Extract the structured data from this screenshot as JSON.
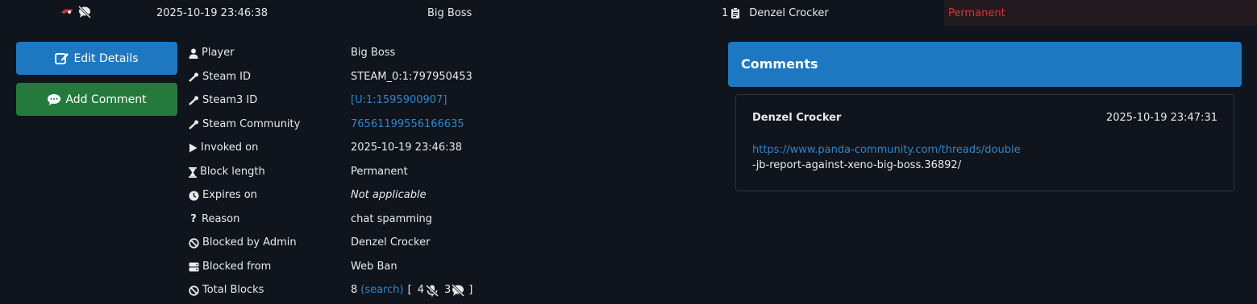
{
  "top_row": {
    "date": "2025-10-19 23:46:38",
    "player": "Big Boss",
    "admin_count": "1",
    "admin": "Denzel Crocker",
    "length": "Permanent"
  },
  "buttons": {
    "edit": "Edit Details",
    "comment": "Add Comment"
  },
  "details": {
    "player_label": "Player",
    "player": "Big Boss",
    "steamid_label": "Steam ID",
    "steamid": "STEAM_0:1:797950453",
    "steam3_label": "Steam3 ID",
    "steam3": "[U:1:1595900907]",
    "community_label": "Steam Community",
    "community": "76561199556166635",
    "invoked_label": "Invoked on",
    "invoked": "2025-10-19 23:46:38",
    "length_label": "Block length",
    "length": "Permanent",
    "expires_label": "Expires on",
    "expires": "Not applicable",
    "reason_label": "Reason",
    "reason": "chat spamming",
    "admin_label": "Blocked by Admin",
    "admin": "Denzel Crocker",
    "from_label": "Blocked from",
    "from": "Web Ban",
    "total_label": "Total Blocks",
    "total": "8",
    "search": "(search)",
    "bracket_open": "[",
    "mutes": "4",
    "gags": "3",
    "bracket_close": "]"
  },
  "comments": {
    "title": "Comments",
    "author": "Denzel Crocker",
    "time": "2025-10-19 23:47:31",
    "link": "https://www.panda-community.com/threads/double",
    "text": "-jb-report-against-xeno-big-boss.36892/"
  },
  "colors": {
    "background": "#10141c",
    "primary": "#1d78c1",
    "success": "#247a3c",
    "danger": "#d7323a",
    "link": "#2f86cc"
  }
}
